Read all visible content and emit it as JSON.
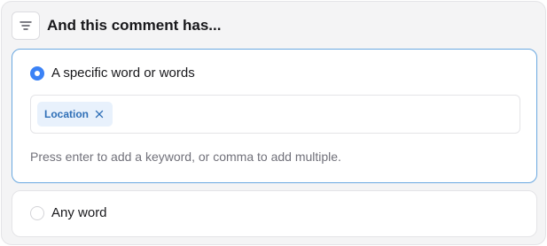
{
  "header": {
    "icon": "filter-lines-icon",
    "title": "And this comment has..."
  },
  "options": [
    {
      "label": "A specific word or words",
      "selected": true,
      "keywords": [
        {
          "label": "Location",
          "remove_icon": "close-icon"
        }
      ],
      "hint": "Press enter to add a keyword, or comma to add multiple."
    },
    {
      "label": "Any word",
      "selected": false
    }
  ],
  "colors": {
    "accent": "#3b82f6",
    "selected_border": "#6aa8e0",
    "chip_background": "#e8f1fc",
    "chip_text": "#2f6fb7",
    "panel_background": "#f4f4f5"
  }
}
